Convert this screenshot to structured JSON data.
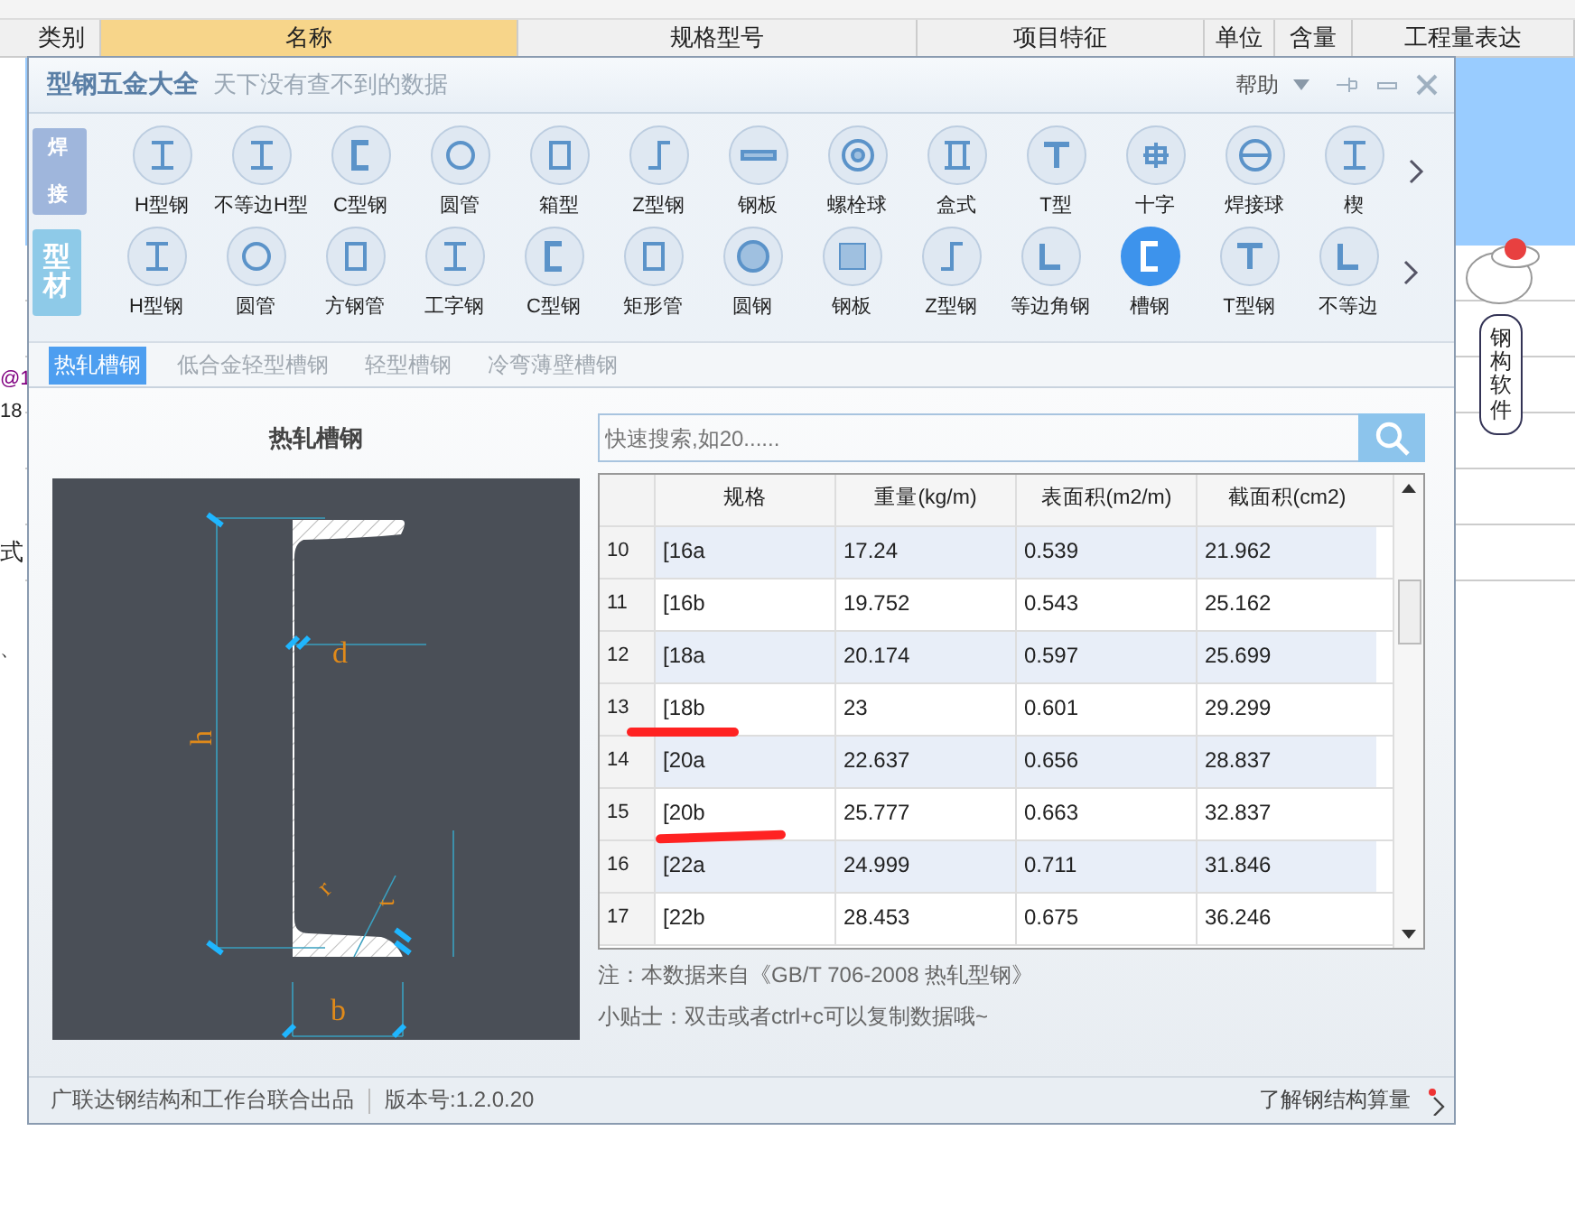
{
  "sheet": {
    "columns": [
      {
        "label": "类别",
        "selected": false
      },
      {
        "label": "名称",
        "selected": true
      },
      {
        "label": "规格型号",
        "selected": false
      },
      {
        "label": "项目特征",
        "selected": false
      },
      {
        "label": "单位",
        "selected": false
      },
      {
        "label": "含量",
        "selected": false
      },
      {
        "label": "工程量表达",
        "selected": false
      }
    ],
    "edge_texts": [
      "@1",
      "18",
      "式",
      "、"
    ]
  },
  "dialog": {
    "title": "型钢五金大全",
    "subtitle": "天下没有查不到的数据",
    "help": "帮助",
    "categories": [
      {
        "label": "焊接",
        "items": [
          {
            "label": "H型钢",
            "selected": false
          },
          {
            "label": "不等边H型",
            "selected": false
          },
          {
            "label": "C型钢",
            "selected": false
          },
          {
            "label": "圆管",
            "selected": false
          },
          {
            "label": "箱型",
            "selected": false
          },
          {
            "label": "Z型钢",
            "selected": false
          },
          {
            "label": "钢板",
            "selected": false
          },
          {
            "label": "螺栓球",
            "selected": false
          },
          {
            "label": "盒式",
            "selected": false
          },
          {
            "label": "T型",
            "selected": false
          },
          {
            "label": "十字",
            "selected": false
          },
          {
            "label": "焊接球",
            "selected": false
          },
          {
            "label": "楔",
            "selected": false
          }
        ]
      },
      {
        "label": "型材",
        "items": [
          {
            "label": "H型钢",
            "selected": false
          },
          {
            "label": "圆管",
            "selected": false
          },
          {
            "label": "方钢管",
            "selected": false
          },
          {
            "label": "工字钢",
            "selected": false
          },
          {
            "label": "C型钢",
            "selected": false
          },
          {
            "label": "矩形管",
            "selected": false
          },
          {
            "label": "圆钢",
            "selected": false
          },
          {
            "label": "钢板",
            "selected": false
          },
          {
            "label": "Z型钢",
            "selected": false
          },
          {
            "label": "等边角钢",
            "selected": false
          },
          {
            "label": "槽钢",
            "selected": true
          },
          {
            "label": "T型钢",
            "selected": false
          },
          {
            "label": "不等边",
            "selected": false
          }
        ]
      }
    ],
    "subtabs": [
      {
        "label": "热轧槽钢",
        "selected": true
      },
      {
        "label": "低合金轻型槽钢",
        "selected": false
      },
      {
        "label": "轻型槽钢",
        "selected": false
      },
      {
        "label": "冷弯薄壁槽钢",
        "selected": false
      }
    ],
    "diagram_title": "热轧槽钢",
    "diagram_labels": [
      "h",
      "d",
      "b",
      "r",
      "t"
    ],
    "search": {
      "placeholder": "快速搜索,如20......"
    },
    "table": {
      "columns": [
        "规格",
        "重量(kg/m)",
        "表面积(m2/m)",
        "截面积(cm2)"
      ],
      "rows": [
        {
          "num": "10",
          "cells": [
            "[16a",
            "17.24",
            "0.539",
            "21.962"
          ]
        },
        {
          "num": "11",
          "cells": [
            "[16b",
            "19.752",
            "0.543",
            "25.162"
          ]
        },
        {
          "num": "12",
          "cells": [
            "[18a",
            "20.174",
            "0.597",
            "25.699"
          ]
        },
        {
          "num": "13",
          "cells": [
            "[18b",
            "23",
            "0.601",
            "29.299"
          ]
        },
        {
          "num": "14",
          "cells": [
            "[20a",
            "22.637",
            "0.656",
            "28.837"
          ]
        },
        {
          "num": "15",
          "cells": [
            "[20b",
            "25.777",
            "0.663",
            "32.837"
          ]
        },
        {
          "num": "16",
          "cells": [
            "[22a",
            "24.999",
            "0.711",
            "31.846"
          ]
        },
        {
          "num": "17",
          "cells": [
            "[22b",
            "28.453",
            "0.675",
            "36.246"
          ]
        }
      ]
    },
    "notes": [
      "注：本数据来自《GB/T  706-2008 热轧型钢》",
      "小贴士：双击或者ctrl+c可以复制数据哦~"
    ],
    "footer": {
      "credit": "广联达钢结构和工作台联合出品",
      "version": "版本号:1.2.0.20",
      "link": "了解钢结构算量"
    }
  },
  "mascot": {
    "bubble": "钢构软件"
  }
}
